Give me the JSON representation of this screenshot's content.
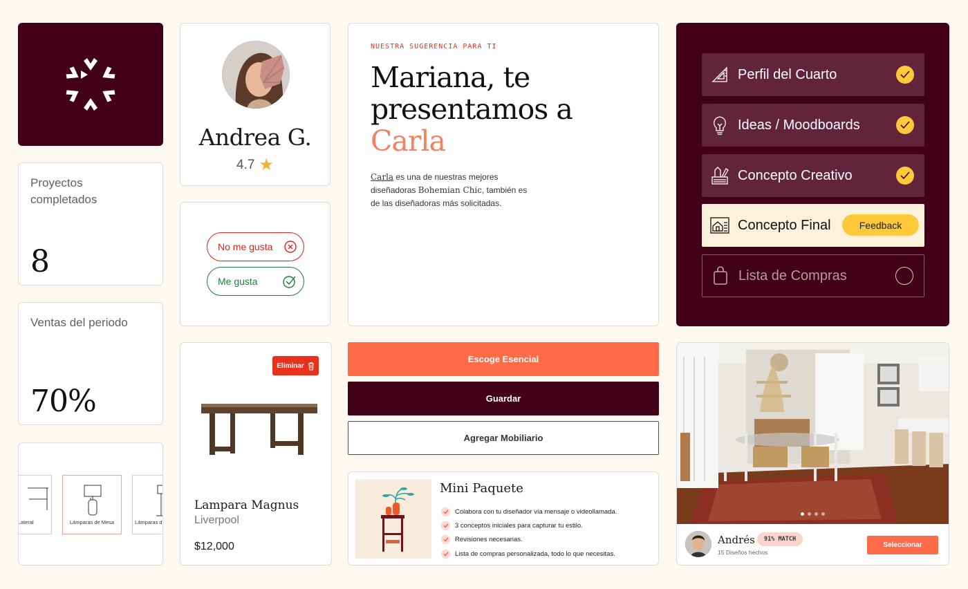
{
  "stats": [
    {
      "label": "Proyectos completados",
      "value": "8"
    },
    {
      "label": "Ventas del periodo",
      "value": "70%"
    }
  ],
  "categories": [
    "Mesa Lateral",
    "Lámparas de Mesa",
    "Lámparas de Pie"
  ],
  "profile": {
    "name": "Andrea G.",
    "rating": "4.7"
  },
  "reactions": {
    "dislike": "No me gusta",
    "like": "Me gusta"
  },
  "product": {
    "delete_label": "Eliminar",
    "name": "Lampara Magnus",
    "store": "Liverpool",
    "price": "$12,000"
  },
  "hero": {
    "eyebrow": "NUESTRA SUGERENCIA PARA TI",
    "title_line1": "Mariana, te",
    "title_line2": "presentamos a",
    "title_accent": "Carla",
    "desc_name": "Carla",
    "desc_part1": " es una de nuestras mejores diseñadoras ",
    "desc_style": "Bohemian Chic",
    "desc_part2": ", también es de las diseñadoras más solicitadas."
  },
  "steps": [
    {
      "label": "Perfil del Cuarto",
      "icon": "ruler-triangle-icon",
      "status": "done"
    },
    {
      "label": "Ideas / Moodboards",
      "icon": "lightbulb-icon",
      "status": "done"
    },
    {
      "label": "Concepto Creativo",
      "icon": "design-tools-icon",
      "status": "done"
    },
    {
      "label": "Concepto Final",
      "icon": "blueprint-icon",
      "status": "active",
      "badge": "Feedback"
    },
    {
      "label": "Lista de Compras",
      "icon": "shopping-bag-icon",
      "status": "pending"
    }
  ],
  "buttons": {
    "esencial": "Escoge Esencial",
    "guardar": "Guardar",
    "agregar": "Agregar Mobiliario"
  },
  "package": {
    "title": "Mini Paquete",
    "features": [
      "Colabora con tu diseñador vía mensaje o videollamada.",
      "3 conceptos iniciales para capturar tu estilo.",
      "Revisiones necesarias.",
      "Lista de compras personalizada, todo lo que necesitas."
    ]
  },
  "designer": {
    "name": "Andrés",
    "match": "91% MATCH",
    "count": "15 Diseños hechos",
    "select_label": "Seleccionar"
  },
  "colors": {
    "brand": "#420018",
    "accent": "#fe6b48",
    "highlight": "#fdc93a",
    "like": "#1c7d40",
    "dislike": "#e0201a"
  }
}
